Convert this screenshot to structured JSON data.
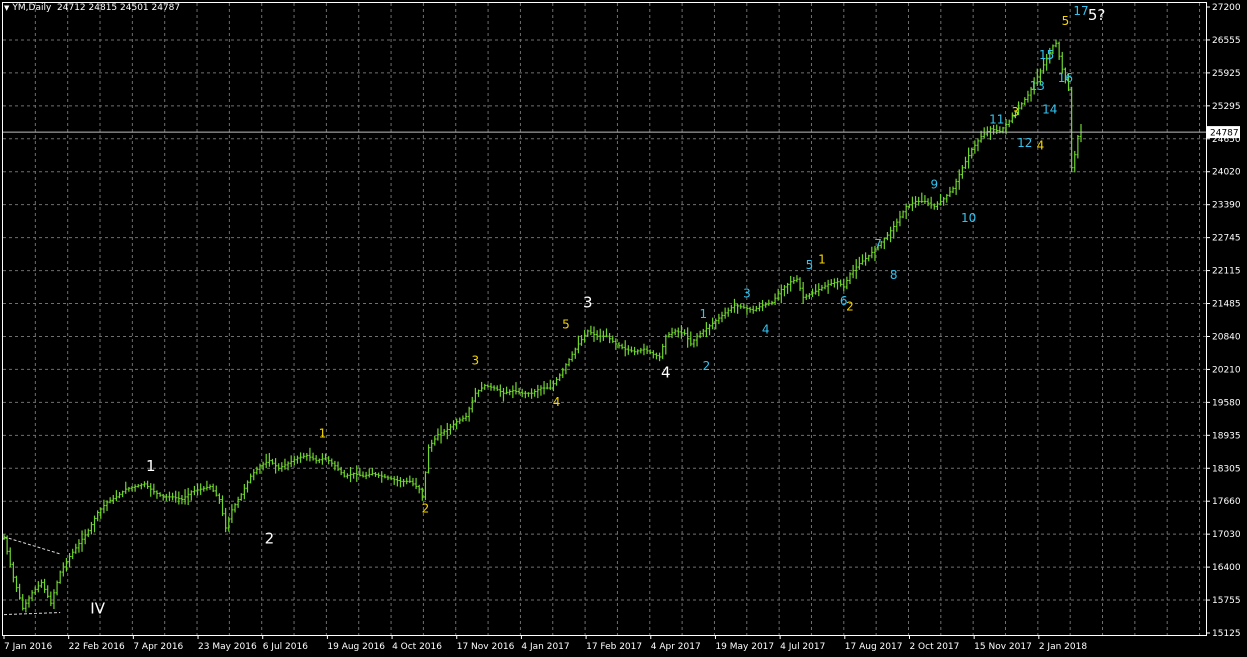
{
  "window": {
    "symbol_label": "YM,Daily",
    "ohlc_label": "24712 24815 24501 24787",
    "title_icon": "triangle-down-icon"
  },
  "colors": {
    "background": "#000000",
    "frame": "#ffffff",
    "grid": "#6f6f6f",
    "candles": "#6fd52f",
    "price_line": "#c0c0c0",
    "wave_white": "#ffffff",
    "wave_yellow": "#f5d400",
    "wave_cyan": "#33c3f0",
    "trendline": "#d8d8d8"
  },
  "chart_data": {
    "type": "bar",
    "subtype": "ohlc-daily",
    "title": "",
    "xlabel": "",
    "ylabel": "",
    "grid": true,
    "ylim": [
      15125,
      27200
    ],
    "x_tick_labels": [
      "7 Jan 2016",
      "22 Feb 2016",
      "7 Apr 2016",
      "23 May 2016",
      "6 Jul 2016",
      "19 Aug 2016",
      "4 Oct 2016",
      "17 Nov 2016",
      "4 Jan 2017",
      "17 Feb 2017",
      "4 Apr 2017",
      "19 May 2017",
      "4 Jul 2017",
      "17 Aug 2017",
      "2 Oct 2017",
      "15 Nov 2017",
      "2 Jan 2018"
    ],
    "y_tick_labels": [
      "27200",
      "26555",
      "25925",
      "25295",
      "24650",
      "24020",
      "23390",
      "22745",
      "22115",
      "21485",
      "20840",
      "20210",
      "19580",
      "18935",
      "18305",
      "17660",
      "17030",
      "16400",
      "15755",
      "15125"
    ],
    "current_price": "24787",
    "price_path": [
      [
        0,
        16950
      ],
      [
        3,
        16200
      ],
      [
        6,
        15600
      ],
      [
        9,
        15900
      ],
      [
        12,
        16100
      ],
      [
        15,
        15700
      ],
      [
        18,
        16300
      ],
      [
        21,
        16600
      ],
      [
        24,
        16850
      ],
      [
        27,
        17100
      ],
      [
        30,
        17450
      ],
      [
        33,
        17650
      ],
      [
        36,
        17750
      ],
      [
        39,
        17900
      ],
      [
        42,
        17950
      ],
      [
        45,
        18000
      ],
      [
        48,
        17850
      ],
      [
        51,
        17750
      ],
      [
        54,
        17750
      ],
      [
        57,
        17700
      ],
      [
        60,
        17850
      ],
      [
        63,
        17900
      ],
      [
        66,
        17950
      ],
      [
        69,
        17700
      ],
      [
        71,
        17150
      ],
      [
        73,
        17500
      ],
      [
        76,
        17800
      ],
      [
        79,
        18150
      ],
      [
        82,
        18350
      ],
      [
        85,
        18450
      ],
      [
        88,
        18300
      ],
      [
        91,
        18400
      ],
      [
        94,
        18500
      ],
      [
        97,
        18550
      ],
      [
        100,
        18450
      ],
      [
        103,
        18500
      ],
      [
        106,
        18350
      ],
      [
        109,
        18150
      ],
      [
        112,
        18200
      ],
      [
        115,
        18150
      ],
      [
        118,
        18200
      ],
      [
        121,
        18150
      ],
      [
        124,
        18100
      ],
      [
        127,
        18050
      ],
      [
        130,
        18050
      ],
      [
        133,
        17900
      ],
      [
        134,
        17750
      ],
      [
        136,
        18700
      ],
      [
        139,
        18950
      ],
      [
        142,
        19050
      ],
      [
        145,
        19200
      ],
      [
        148,
        19300
      ],
      [
        151,
        19750
      ],
      [
        154,
        19900
      ],
      [
        157,
        19850
      ],
      [
        160,
        19750
      ],
      [
        163,
        19800
      ],
      [
        166,
        19750
      ],
      [
        169,
        19750
      ],
      [
        172,
        19850
      ],
      [
        175,
        19850
      ],
      [
        178,
        20100
      ],
      [
        181,
        20400
      ],
      [
        184,
        20700
      ],
      [
        187,
        20950
      ],
      [
        190,
        20850
      ],
      [
        193,
        20850
      ],
      [
        196,
        20700
      ],
      [
        199,
        20600
      ],
      [
        202,
        20550
      ],
      [
        205,
        20600
      ],
      [
        208,
        20500
      ],
      [
        210,
        20450
      ],
      [
        212,
        20850
      ],
      [
        215,
        20950
      ],
      [
        218,
        20900
      ],
      [
        220,
        20700
      ],
      [
        222,
        20850
      ],
      [
        225,
        21000
      ],
      [
        228,
        21150
      ],
      [
        231,
        21300
      ],
      [
        234,
        21450
      ],
      [
        237,
        21400
      ],
      [
        240,
        21350
      ],
      [
        243,
        21450
      ],
      [
        246,
        21500
      ],
      [
        249,
        21750
      ],
      [
        252,
        21900
      ],
      [
        254,
        21950
      ],
      [
        256,
        21600
      ],
      [
        258,
        21650
      ],
      [
        261,
        21750
      ],
      [
        264,
        21850
      ],
      [
        267,
        21900
      ],
      [
        269,
        21800
      ],
      [
        271,
        22050
      ],
      [
        274,
        22250
      ],
      [
        277,
        22400
      ],
      [
        280,
        22600
      ],
      [
        283,
        22800
      ],
      [
        286,
        23050
      ],
      [
        289,
        23350
      ],
      [
        292,
        23450
      ],
      [
        295,
        23450
      ],
      [
        298,
        23350
      ],
      [
        301,
        23500
      ],
      [
        304,
        23700
      ],
      [
        307,
        24100
      ],
      [
        310,
        24450
      ],
      [
        313,
        24700
      ],
      [
        316,
        24850
      ],
      [
        319,
        24800
      ],
      [
        322,
        25000
      ],
      [
        325,
        25250
      ],
      [
        328,
        25500
      ],
      [
        331,
        25850
      ],
      [
        334,
        26200
      ],
      [
        336,
        26450
      ],
      [
        337,
        26500
      ],
      [
        339,
        26000
      ],
      [
        341,
        25600
      ],
      [
        342,
        24100
      ],
      [
        343,
        24350
      ],
      [
        344,
        24700
      ],
      [
        345,
        24787
      ]
    ],
    "annotations": [
      {
        "text": "IV",
        "color": "white",
        "x": 30,
        "y": 15500
      },
      {
        "text": "1",
        "color": "white",
        "x": 47,
        "y": 18250
      },
      {
        "text": "2",
        "color": "white",
        "x": 85,
        "y": 16850
      },
      {
        "text": "1",
        "color": "yellow",
        "x": 102,
        "y": 18900
      },
      {
        "text": "2",
        "color": "yellow",
        "x": 135,
        "y": 17450
      },
      {
        "text": "3",
        "color": "yellow",
        "x": 151,
        "y": 20300
      },
      {
        "text": "4",
        "color": "yellow",
        "x": 177,
        "y": 19500
      },
      {
        "text": "5",
        "color": "yellow",
        "x": 180,
        "y": 21000
      },
      {
        "text": "3",
        "color": "white",
        "x": 187,
        "y": 21400
      },
      {
        "text": "4",
        "color": "white",
        "x": 212,
        "y": 20050
      },
      {
        "text": "1",
        "color": "cyan",
        "x": 224,
        "y": 21200
      },
      {
        "text": "2",
        "color": "cyan",
        "x": 225,
        "y": 20200
      },
      {
        "text": "3",
        "color": "cyan",
        "x": 238,
        "y": 21600
      },
      {
        "text": "4",
        "color": "cyan",
        "x": 244,
        "y": 20900
      },
      {
        "text": "5",
        "color": "cyan",
        "x": 258,
        "y": 22150
      },
      {
        "text": "1",
        "color": "yellow",
        "x": 262,
        "y": 22250
      },
      {
        "text": "6",
        "color": "cyan",
        "x": 269,
        "y": 21450
      },
      {
        "text": "2",
        "color": "yellow",
        "x": 271,
        "y": 21350
      },
      {
        "text": "7",
        "color": "cyan",
        "x": 280,
        "y": 22550
      },
      {
        "text": "8",
        "color": "cyan",
        "x": 285,
        "y": 21950
      },
      {
        "text": "9",
        "color": "cyan",
        "x": 298,
        "y": 23700
      },
      {
        "text": "10",
        "color": "cyan",
        "x": 309,
        "y": 23050
      },
      {
        "text": "11",
        "color": "cyan",
        "x": 318,
        "y": 24950
      },
      {
        "text": "3",
        "color": "yellow",
        "x": 324,
        "y": 25100
      },
      {
        "text": "12",
        "color": "cyan",
        "x": 327,
        "y": 24500
      },
      {
        "text": "4",
        "color": "yellow",
        "x": 332,
        "y": 24450
      },
      {
        "text": "13",
        "color": "cyan",
        "x": 331,
        "y": 25600
      },
      {
        "text": "14",
        "color": "cyan",
        "x": 335,
        "y": 25150
      },
      {
        "text": "15",
        "color": "cyan",
        "x": 334,
        "y": 26200
      },
      {
        "text": "16",
        "color": "cyan",
        "x": 340,
        "y": 25750
      },
      {
        "text": "5",
        "color": "yellow",
        "x": 340,
        "y": 26850
      },
      {
        "text": "17",
        "color": "cyan",
        "x": 345,
        "y": 27050
      },
      {
        "text": "5?",
        "color": "white",
        "x": 350,
        "y": 26950
      }
    ]
  }
}
